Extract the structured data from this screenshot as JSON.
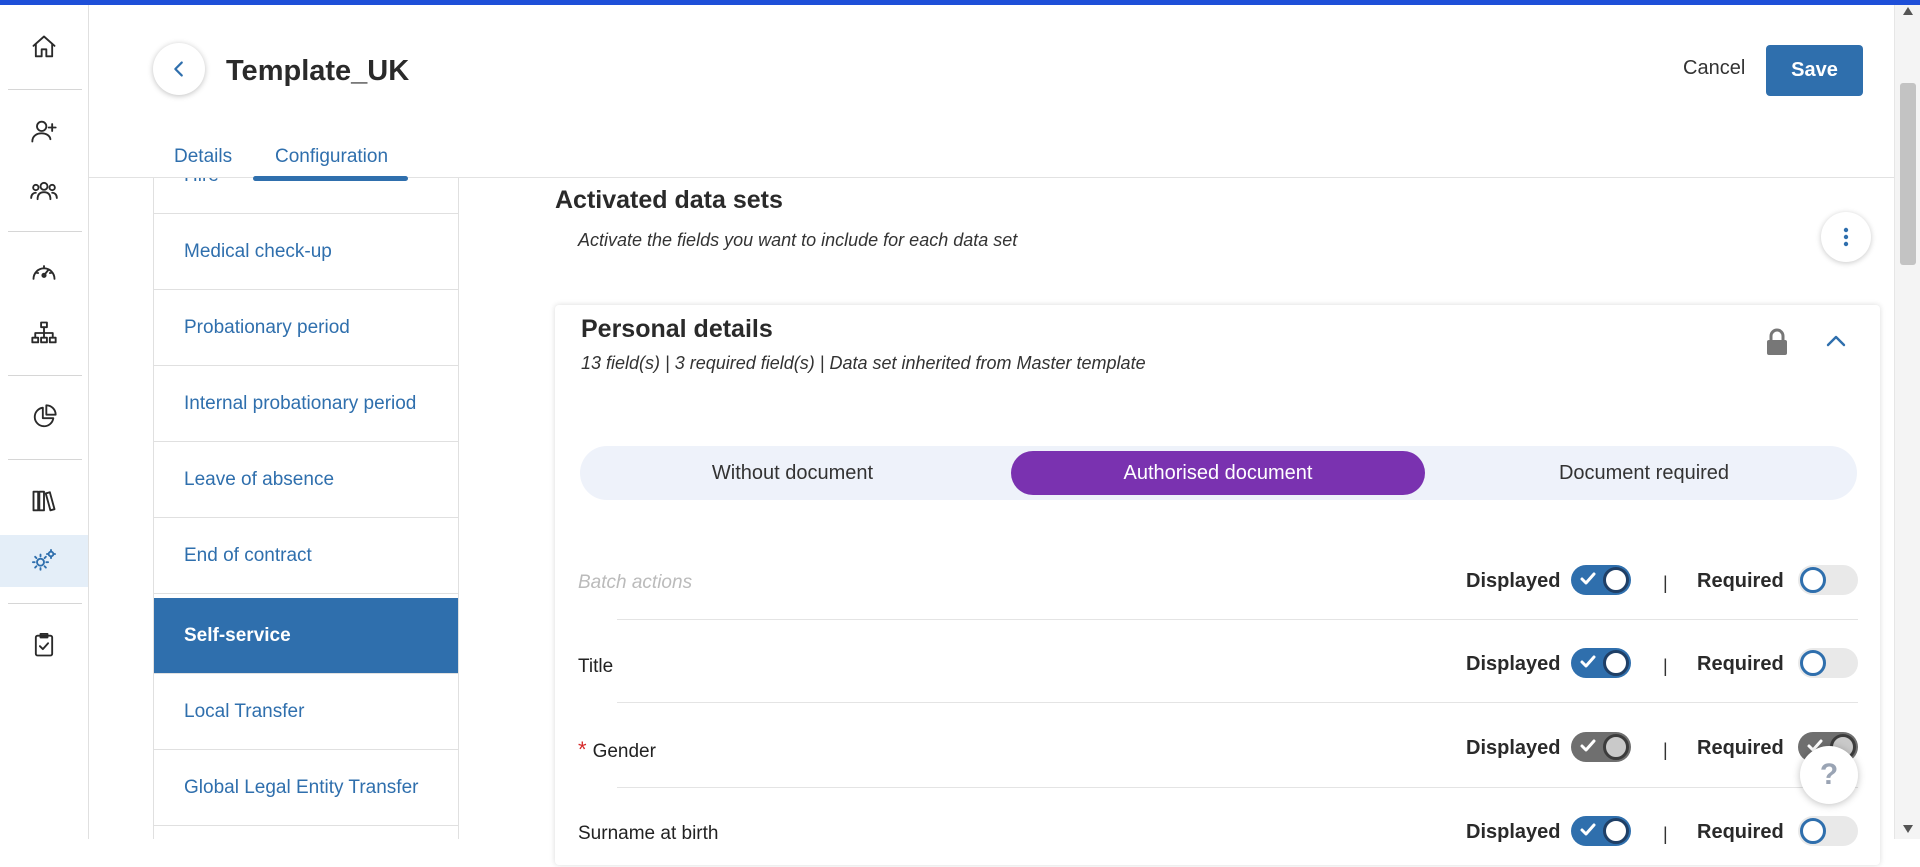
{
  "header": {
    "title": "Template_UK",
    "cancel_label": "Cancel",
    "save_label": "Save",
    "tabs": [
      {
        "label": "Details",
        "active": false
      },
      {
        "label": "Configuration",
        "active": true
      }
    ]
  },
  "rail": {
    "items": [
      {
        "icon": "home-icon"
      },
      {
        "icon": "add-user-icon"
      },
      {
        "icon": "team-icon"
      },
      {
        "icon": "dashboard-icon"
      },
      {
        "icon": "org-chart-icon"
      },
      {
        "icon": "pie-chart-icon"
      },
      {
        "icon": "library-icon"
      },
      {
        "icon": "settings-icon",
        "active": true
      },
      {
        "icon": "clipboard-check-icon"
      }
    ]
  },
  "process_list": {
    "items": [
      {
        "label": "Hire"
      },
      {
        "label": "Medical check-up"
      },
      {
        "label": "Probationary period"
      },
      {
        "label": "Internal probationary period"
      },
      {
        "label": "Leave of absence"
      },
      {
        "label": "End of contract"
      },
      {
        "label": "Self-service",
        "active": true
      },
      {
        "label": "Local Transfer"
      },
      {
        "label": "Global Legal Entity Transfer"
      }
    ]
  },
  "main": {
    "title": "Activated data sets",
    "subtitle": "Activate the fields you want to include for each data set"
  },
  "card": {
    "title": "Personal details",
    "meta": "13 field(s) | 3 required field(s) | Data set inherited from Master template",
    "segments": [
      {
        "label": "Without document"
      },
      {
        "label": "Authorised document",
        "active": true
      },
      {
        "label": "Document required"
      }
    ],
    "displayed_label": "Displayed",
    "required_label": "Required",
    "separator": "|",
    "rows": [
      {
        "label": "Batch actions",
        "required_marker": "",
        "displayed": "on",
        "required": "off"
      },
      {
        "label": "Title",
        "required_marker": "",
        "displayed": "on",
        "required": "off"
      },
      {
        "label": "Gender",
        "required_marker": "*",
        "displayed": "locked-on",
        "required": "locked-on"
      },
      {
        "label": "Surname at birth",
        "required_marker": "",
        "displayed": "on",
        "required": "off"
      }
    ]
  },
  "help": {
    "label": "?"
  },
  "colors": {
    "primary": "#2f6fad",
    "segment_active": "#7a32b0",
    "top_bar": "#1e4fd8",
    "required_star": "#d62b2b"
  }
}
